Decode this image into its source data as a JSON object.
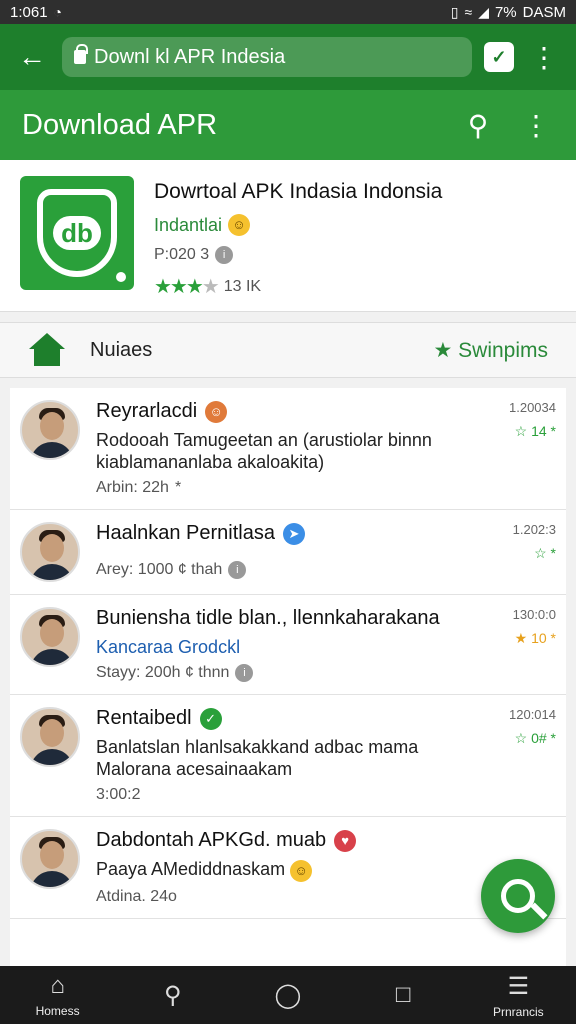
{
  "status": {
    "time": "1:061",
    "battery": "7%",
    "right_text": "DASM"
  },
  "browser": {
    "url": "Downl kl APR Indesia"
  },
  "appbar": {
    "title": "Download APR"
  },
  "app": {
    "name": "Dowrtoal APK Indasia Indonsia",
    "developer": "Indantlai",
    "meta": "P:020 3",
    "rating_count": "13 IK",
    "stars": 3
  },
  "tabs": {
    "left_label": "Nuiaes",
    "right_label": "★ Swinpims"
  },
  "feed": [
    {
      "name": "Reyrarlacdi",
      "badge": "orange",
      "text": "Rodooah Tamugeetan an (arustiolar binnn kiablamananlaba akaloakita)",
      "sub": "Arbin: 22h",
      "date": "1.20034",
      "score": "14"
    },
    {
      "name": "Haalnkan Pernitlasa",
      "badge": "blue",
      "text": "",
      "sub": "Arey: 1000  ¢ thah",
      "date": "1.202:3",
      "score": ""
    },
    {
      "name": "Buniensha tidle blan., llennkaharakana",
      "badge": "",
      "text": "Kancaraa                 Grodckl",
      "sub": "Stayy: 200h  ¢ thnn",
      "date": "130:0:0",
      "score": "10"
    },
    {
      "name": "Rentaibedl",
      "badge": "green",
      "text": "Banlatslan hlanlsakakkand adbac mama Malorana acesainaakam",
      "sub": "3:00:2",
      "date": "120:014",
      "score": "0#"
    },
    {
      "name": "Dabdontah APKGd. muab",
      "badge": "red",
      "text": "Paaya AMediddnaskam",
      "sub": "Atdina. 24o",
      "date": "",
      "score": ""
    }
  ],
  "nav": {
    "home": "Homess",
    "profile": "Prnrancis"
  },
  "colors": {
    "primary": "#2e9a3a",
    "primary_dark": "#1e7f2c"
  }
}
